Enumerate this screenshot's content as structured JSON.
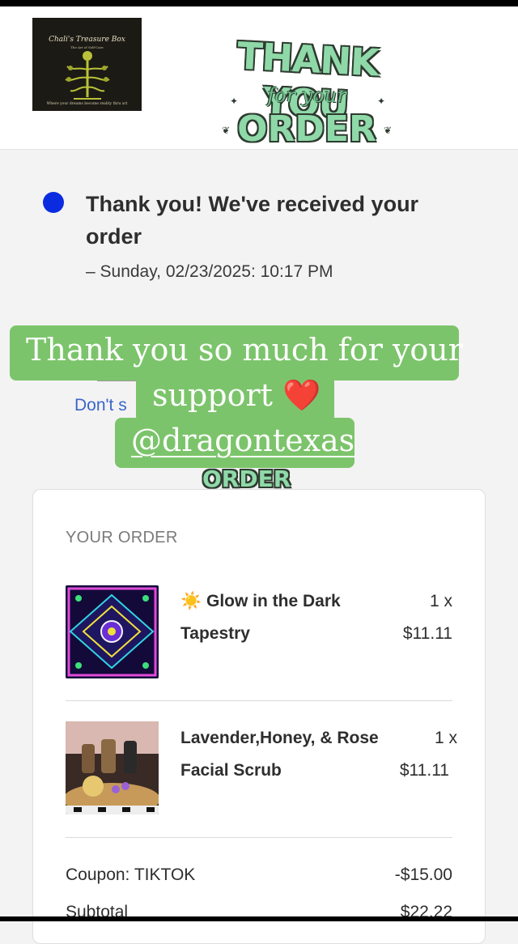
{
  "header": {
    "logo": {
      "title": "Chali's Treasure Box",
      "tagline": "The Art of Self-Care",
      "subtitle": "Where your dreams become reality thru art"
    },
    "badge": {
      "line1": "THANK YOU",
      "line2": "for your",
      "line3": "ORDER"
    }
  },
  "status": {
    "title": "Thank you! We've received your order",
    "date": "– Sunday, 02/23/2025: 10:17 PM"
  },
  "partial_link": "Don't s",
  "sticker": {
    "line1": "Thank you so much for your",
    "line2": "support ❤️",
    "handle": "@dragontexas"
  },
  "mini_badge": "ORDER",
  "order": {
    "title": "YOUR ORDER",
    "items": [
      {
        "name_line1": "☀️ Glow in the Dark",
        "name_line2": "Tapestry",
        "qty": "1 x",
        "price": "$11.11"
      },
      {
        "name_line1": "Lavender,Honey, & Rose",
        "name_line2": "Facial Scrub",
        "qty": "1 x",
        "price": "$11.11"
      }
    ],
    "coupon_label": "Coupon: TIKTOK",
    "coupon_value": "-$15.00",
    "subtotal_label": "Subtotal",
    "subtotal_value": "$22.22"
  },
  "colors": {
    "status_dot": "#0b2be0",
    "sticker_bg": "#7cc46b",
    "link": "#3a66c9",
    "badge_green": "#8fd9a8"
  }
}
